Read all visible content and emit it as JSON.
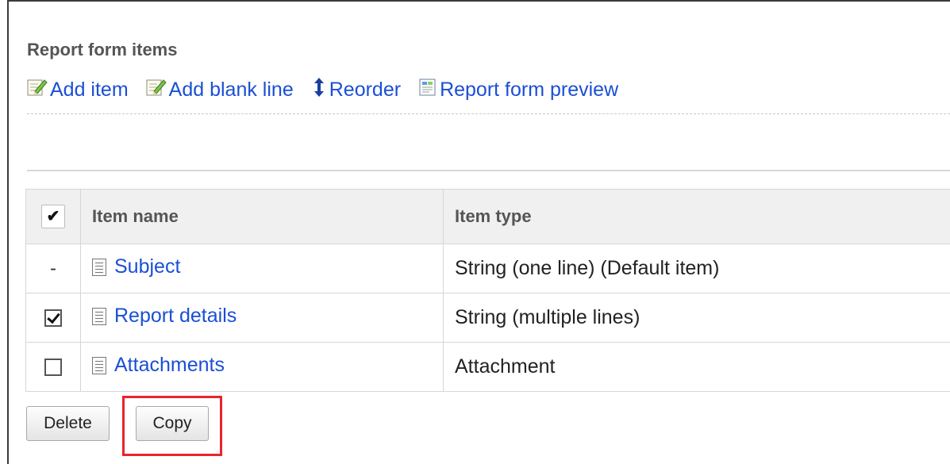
{
  "section": {
    "title": "Report form items"
  },
  "toolbar": {
    "add_item": "Add item",
    "add_blank_line": "Add blank line",
    "reorder": "Reorder",
    "report_form_preview": "Report form preview"
  },
  "table": {
    "check_header": "✔",
    "columns": [
      "Item name",
      "Item type"
    ],
    "rows": [
      {
        "check": "-",
        "name": "Subject",
        "type": "String (one line) (Default item)"
      },
      {
        "check": "checked",
        "name": "Report details",
        "type": "String (multiple lines)"
      },
      {
        "check": "unchecked",
        "name": "Attachments",
        "type": "Attachment"
      }
    ]
  },
  "buttons": {
    "delete": "Delete",
    "copy": "Copy"
  },
  "colors": {
    "link": "#1a4fd6",
    "highlight": "#e8242c",
    "header_bg": "#f0f0f0"
  }
}
